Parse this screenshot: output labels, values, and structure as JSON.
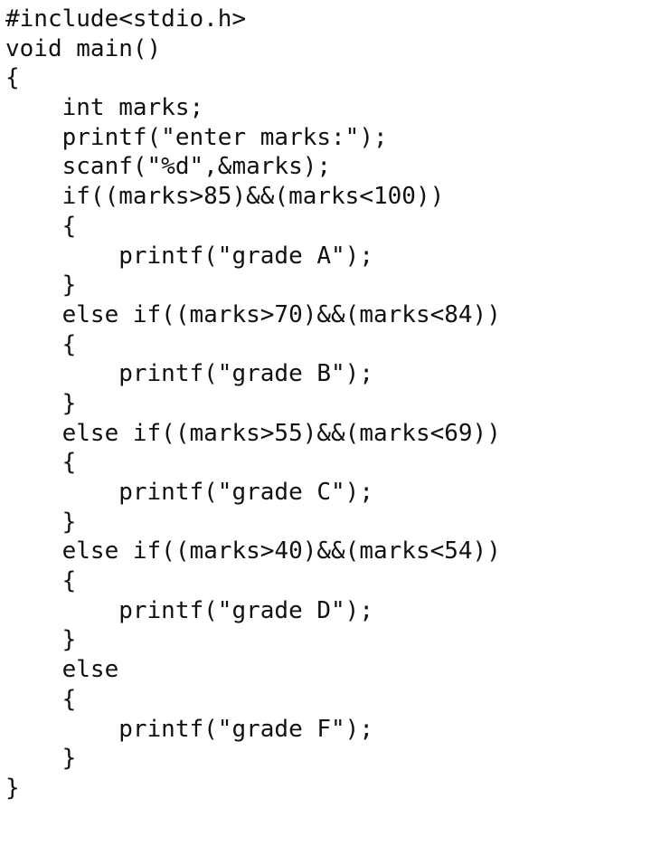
{
  "code": {
    "lines": [
      "#include<stdio.h>",
      "void main()",
      "{",
      "    int marks;",
      "    printf(\"enter marks:\");",
      "    scanf(\"%d\",&marks);",
      "    if((marks>85)&&(marks<100))",
      "    {",
      "        printf(\"grade A\");",
      "    }",
      "    else if((marks>70)&&(marks<84))",
      "    {",
      "        printf(\"grade B\");",
      "    }",
      "    else if((marks>55)&&(marks<69))",
      "    {",
      "        printf(\"grade C\");",
      "    }",
      "    else if((marks>40)&&(marks<54))",
      "    {",
      "        printf(\"grade D\");",
      "    }",
      "    else",
      "    {",
      "        printf(\"grade F\");",
      "    }",
      "}"
    ]
  }
}
